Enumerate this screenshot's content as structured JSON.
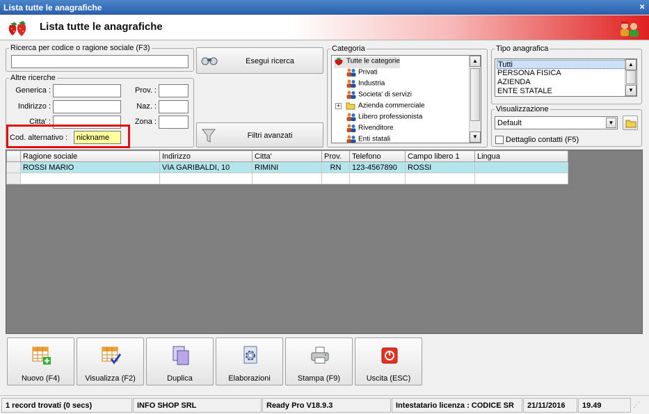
{
  "window": {
    "title": "Lista tutte le anagrafiche",
    "close_glyph": "×"
  },
  "header": {
    "title": "Lista tutte le anagrafiche",
    "logo_icon": "strawberry-icon",
    "user_icon": "users-icon"
  },
  "search": {
    "legend": "Ricerca per codice o ragione sociale (F3)",
    "value": "",
    "execute_label": "Esegui ricerca",
    "advanced_label": "Filtri avanzati"
  },
  "other": {
    "legend": "Altre ricerche",
    "generica_label": "Generica :",
    "generica_value": "",
    "indirizzo_label": "Indirizzo :",
    "indirizzo_value": "",
    "citta_label": "Citta' :",
    "citta_value": "",
    "prov_label": "Prov. :",
    "prov_value": "",
    "naz_label": "Naz. :",
    "naz_value": "",
    "zona_label": "Zona :",
    "zona_value": "",
    "cod_alt_label": "Cod. alternativo :",
    "cod_alt_value": "nickname"
  },
  "categoria": {
    "legend": "Categoria",
    "items": [
      {
        "label": "Tutte le categorie",
        "icon": "strawberry-icon",
        "selected": true
      },
      {
        "label": "Privati",
        "icon": "people-icon"
      },
      {
        "label": "Industria",
        "icon": "people-icon"
      },
      {
        "label": "Societa' di servizi",
        "icon": "people-icon"
      },
      {
        "label": "Azienda commerciale",
        "icon": "folder-icon"
      },
      {
        "label": "Libero professionista",
        "icon": "people-icon"
      },
      {
        "label": "Rivenditore",
        "icon": "people-icon"
      },
      {
        "label": "Enti statali",
        "icon": "people-icon"
      }
    ]
  },
  "tipo": {
    "legend": "Tipo anagrafica",
    "items": [
      "Tutti",
      "PERSONA FISICA",
      "AZIENDA",
      "ENTE STATALE"
    ]
  },
  "visual": {
    "legend": "Visualizzazione",
    "selected": "Default",
    "detail_label": "Dettaglio contatti (F5)"
  },
  "grid": {
    "columns": [
      "Ragione sociale",
      "Indirizzo",
      "Citta'",
      "Prov.",
      "Telefono",
      "Campo libero 1",
      "Lingua"
    ],
    "rows": [
      [
        "ROSSI MARIO",
        "VIA GARIBALDI, 10",
        "RIMINI",
        "RN",
        "123-4567890",
        "ROSSI",
        ""
      ]
    ]
  },
  "buttons": [
    {
      "label": "Nuovo (F4)",
      "icon": "grid-add-icon"
    },
    {
      "label": "Visualizza (F2)",
      "icon": "grid-check-icon"
    },
    {
      "label": "Duplica",
      "icon": "duplicate-icon"
    },
    {
      "label": "Elaborazioni",
      "icon": "gear-doc-icon"
    },
    {
      "label": "Stampa (F9)",
      "icon": "printer-icon"
    },
    {
      "label": "Uscita (ESC)",
      "icon": "power-icon"
    }
  ],
  "status": {
    "records": "1 record trovati (0 secs)",
    "company": "INFO SHOP SRL",
    "version": "Ready Pro V18.9.3",
    "license": "Intestatario licenza : CODICE SR",
    "date": "21/11/2016",
    "time": "19.49"
  },
  "colors": {
    "title_bar": "#2c63b0",
    "header_red": "#e02020",
    "selected_row": "#b4e4ec",
    "highlight_input": "#ffff99",
    "annotation_red": "#e01010"
  }
}
